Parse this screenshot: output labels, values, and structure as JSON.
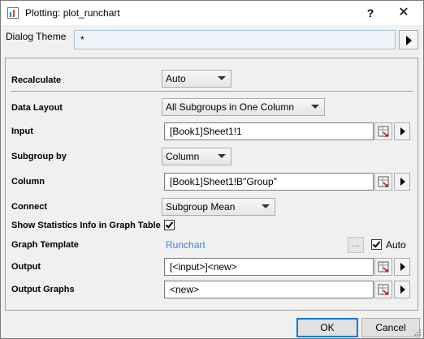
{
  "window": {
    "title": "Plotting: plot_runchart",
    "help_label": "?",
    "close_label": "✕",
    "icon": "app-icon"
  },
  "theme": {
    "label": "Dialog Theme",
    "value": "*"
  },
  "form": {
    "recalculate": {
      "label": "Recalculate",
      "value": "Auto"
    },
    "data_layout": {
      "label": "Data Layout",
      "value": "All Subgroups in One Column"
    },
    "input": {
      "label": "Input",
      "value": "[Book1]Sheet1!1"
    },
    "subgroup_by": {
      "label": "Subgroup by",
      "value": "Column"
    },
    "column": {
      "label": "Column",
      "value": "[Book1]Sheet1!B\"Group\""
    },
    "connect": {
      "label": "Connect",
      "value": "Subgroup Mean"
    },
    "show_stats": {
      "label": "Show Statistics Info in Graph Table",
      "checked": true
    },
    "graph_template": {
      "label": "Graph Template",
      "value": "Runchart",
      "browse_label": "...",
      "auto_label": "Auto",
      "auto_checked": true
    },
    "output": {
      "label": "Output",
      "value": "[<input>]<new>"
    },
    "output_graphs": {
      "label": "Output Graphs",
      "value": "<new>"
    }
  },
  "buttons": {
    "ok": "OK",
    "cancel": "Cancel"
  },
  "icons": {
    "picker": "range-picker-icon",
    "expand": "expand-arrow-icon",
    "dropdown": "chevron-down-icon"
  },
  "colors": {
    "link": "#3f83d6",
    "default_button_border": "#0078d7",
    "theme_field_bg": "#eef4f9"
  }
}
